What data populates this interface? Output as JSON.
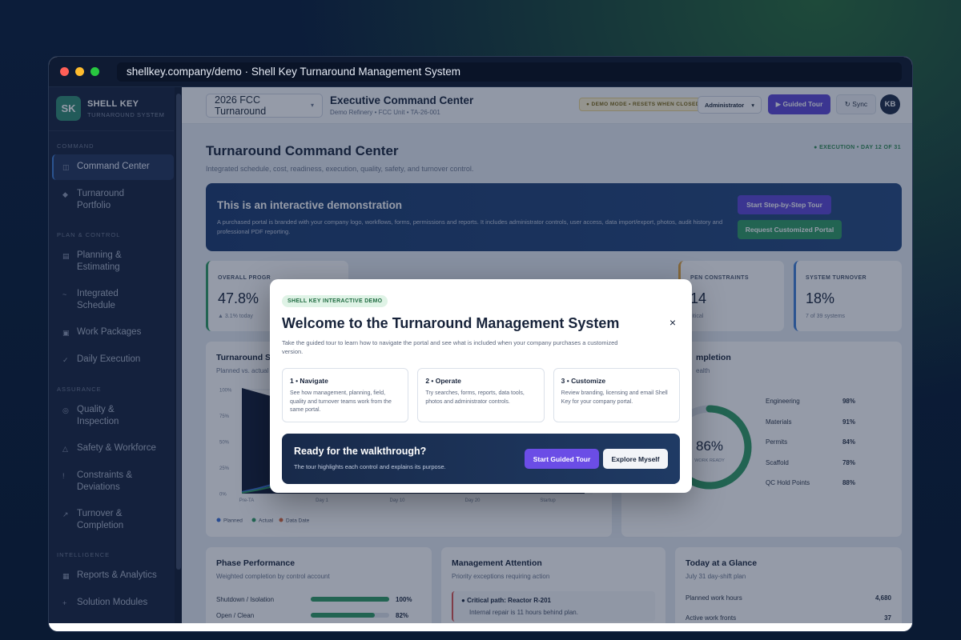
{
  "browser": {
    "url": "shellkey.company/demo · Shell Key Turnaround Management System"
  },
  "brand": {
    "logo": "SK",
    "name": "SHELL KEY",
    "sub": "TURNAROUND SYSTEM"
  },
  "sidebar": {
    "sections": [
      {
        "label": "COMMAND",
        "items": [
          {
            "icon": "◫",
            "label": "Command Center",
            "active": true
          },
          {
            "icon": "◆",
            "label": "Turnaround Portfolio"
          }
        ]
      },
      {
        "label": "PLAN & CONTROL",
        "items": [
          {
            "icon": "▤",
            "label": "Planning & Estimating"
          },
          {
            "icon": "~",
            "label": "Integrated Schedule"
          },
          {
            "icon": "▣",
            "label": "Work Packages"
          },
          {
            "icon": "✓",
            "label": "Daily Execution"
          }
        ]
      },
      {
        "label": "ASSURANCE",
        "items": [
          {
            "icon": "◎",
            "label": "Quality & Inspection"
          },
          {
            "icon": "△",
            "label": "Safety & Workforce"
          },
          {
            "icon": "!",
            "label": "Constraints & Deviations"
          },
          {
            "icon": "↗",
            "label": "Turnover & Completion"
          }
        ]
      },
      {
        "label": "INTELLIGENCE",
        "items": [
          {
            "icon": "▦",
            "label": "Reports & Analytics"
          },
          {
            "icon": "+",
            "label": "Solution Modules"
          },
          {
            "icon": "⇅",
            "label": "Data & Photos"
          },
          {
            "icon": "⚙",
            "label": "Admin & Licensing"
          }
        ]
      }
    ]
  },
  "topbar": {
    "project": "2026 FCC Turnaround",
    "title": "Executive Command Center",
    "subtitle": "Demo Refinery • FCC Unit • TA-26-001",
    "demo_badge": "● DEMO MODE • RESETS WHEN CLOSED",
    "role": "Administrator",
    "tour_btn": "▶ Guided Tour",
    "sync_btn": "↻ Sync",
    "avatar": "KB"
  },
  "page": {
    "title": "Turnaround Command Center",
    "subtitle": "Integrated schedule, cost, readiness, execution, quality, safety, and turnover control.",
    "status": "● EXECUTION • DAY 12 OF 31"
  },
  "banner": {
    "title": "This is an interactive demonstration",
    "text": "A purchased portal is branded with your company logo, workflows, forms, permissions and reports. It includes administrator controls, user access, data import/export, photos, audit history and professional PDF reporting.",
    "btn1": "Start Step-by-Step Tour",
    "btn2": "Request Customized Portal"
  },
  "kpis": [
    {
      "label": "OVERALL PROGR",
      "value": "47.8%",
      "note": "▲ 3.1% today",
      "accent": "#2f9b63"
    },
    {
      "label": "PEN CONSTRAINTS",
      "value": "14",
      "note": "ritical",
      "accent": "#e0a23a"
    },
    {
      "label": "SYSTEM TURNOVER",
      "value": "18%",
      "note": "7 of 39 systems",
      "accent": "#3f7fd6"
    }
  ],
  "scurve": {
    "title": "Turnaround S-",
    "sub": "Planned vs. actual",
    "y_ticks": [
      "100%",
      "75%",
      "50%",
      "25%",
      "0%"
    ],
    "x_ticks": [
      "Pre-TA",
      "Day 1",
      "Day 10",
      "Day 20",
      "Startup"
    ],
    "legend": [
      "Planned",
      "Actual",
      "Data Date"
    ]
  },
  "completion": {
    "title": "mpletion",
    "sub": "ealth",
    "gauge_value": 86,
    "gauge_label": "86%",
    "gauge_sub": "WORK READY",
    "items": [
      {
        "label": "Engineering",
        "value": "98%"
      },
      {
        "label": "Materials",
        "value": "91%"
      },
      {
        "label": "Permits",
        "value": "84%"
      },
      {
        "label": "Scaffold",
        "value": "78%"
      },
      {
        "label": "QC Hold Points",
        "value": "88%"
      }
    ]
  },
  "phase": {
    "title": "Phase Performance",
    "sub": "Weighted completion by control account",
    "rows": [
      {
        "label": "Shutdown / Isolation",
        "value": "100%",
        "pct": 100
      },
      {
        "label": "Open / Clean",
        "value": "82%",
        "pct": 82
      }
    ]
  },
  "attention": {
    "title": "Management Attention",
    "sub": "Priority exceptions requiring action",
    "item_title": "Critical path: Reactor R-201",
    "item_text": "Internal repair is 11 hours behind plan."
  },
  "glance": {
    "title": "Today at a Glance",
    "sub": "July 31 day-shift plan",
    "rows": [
      {
        "label": "Planned work hours",
        "value": "4,680"
      },
      {
        "label": "Active work fronts",
        "value": "37"
      }
    ]
  },
  "modal": {
    "badge": "SHELL KEY INTERACTIVE DEMO",
    "title": "Welcome to the Turnaround Management System",
    "subtitle": "Take the guided tour to learn how to navigate the portal and see what is included when your company purchases a customized version.",
    "close": "×",
    "steps": [
      {
        "title": "1 • Navigate",
        "desc": "See how management, planning, field, quality and turnover teams work from the same portal."
      },
      {
        "title": "2 • Operate",
        "desc": "Try searches, forms, reports, data tools, photos and administrator controls."
      },
      {
        "title": "3 • Customize",
        "desc": "Review branding, licensing and email Shell Key for your company portal."
      }
    ],
    "walk_title": "Ready for the walkthrough?",
    "walk_desc": "The tour highlights each control and explains its purpose.",
    "start_btn": "Start Guided Tour",
    "explore_btn": "Explore Myself"
  },
  "colors": {
    "accent": "#5b46d6",
    "success": "#2f9b63",
    "sidebar": "#15223c"
  }
}
